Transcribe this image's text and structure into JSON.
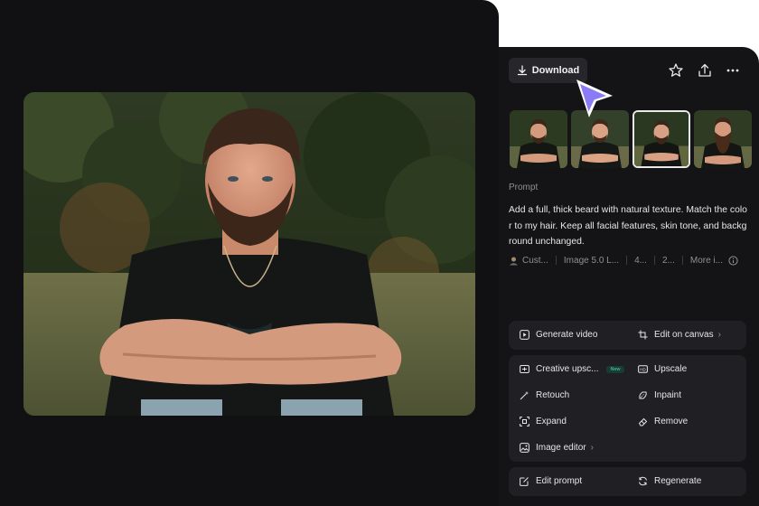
{
  "toolbar": {
    "download_label": "Download",
    "icons": [
      "download-icon",
      "star-icon",
      "share-icon",
      "more-icon"
    ]
  },
  "thumbnails": {
    "count": 4,
    "selected_index": 2
  },
  "prompt": {
    "label": "Prompt",
    "text": "Add a full, thick beard with natural texture. Match the color to my hair. Keep all facial features, skin tone, and background unchanged."
  },
  "meta": {
    "items": [
      "Cust...",
      "Image 5.0 L...",
      "4...",
      "2...",
      "More i..."
    ]
  },
  "actions": {
    "generate_video": "Generate video",
    "edit_on_canvas": "Edit on canvas",
    "creative_upscale": "Creative upsc...",
    "new_badge": "New",
    "upscale": "Upscale",
    "retouch": "Retouch",
    "inpaint": "Inpaint",
    "expand": "Expand",
    "remove": "Remove",
    "image_editor": "Image editor",
    "edit_prompt": "Edit prompt",
    "regenerate": "Regenerate"
  },
  "colors": {
    "background": "#111114",
    "panel": "#141417",
    "card": "#1f1f24",
    "cursor_accent": "#8b7cf6",
    "new_badge": "#58d6b0"
  }
}
